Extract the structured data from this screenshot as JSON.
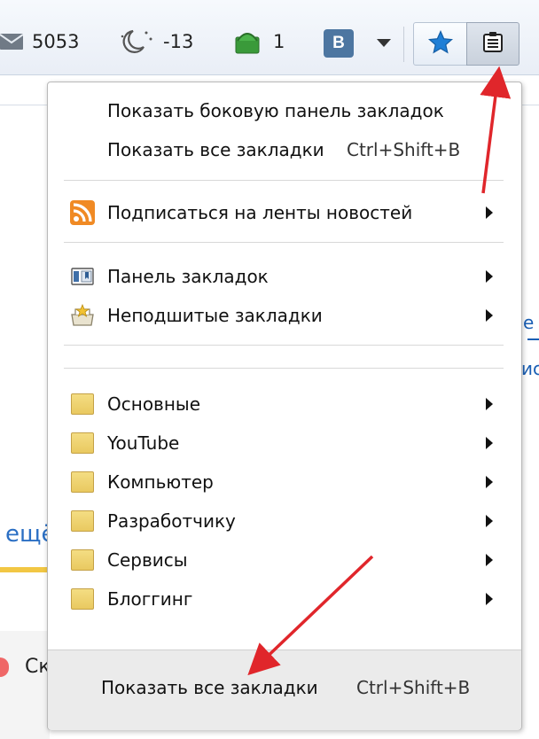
{
  "toolbar": {
    "mail_count": "5053",
    "weather_value": "-13",
    "green_count": "1",
    "vk_label": "В"
  },
  "background": {
    "left_text": "ещё",
    "left_snippet": "Ск",
    "right_text_1": "е",
    "right_text_2": "ис"
  },
  "menu": {
    "top_items": [
      {
        "label": "Показать боковую панель закладок"
      },
      {
        "label": "Показать все закладки",
        "shortcut": "Ctrl+Shift+B"
      }
    ],
    "feeds_item": {
      "label": "Подписаться на ленты новостей",
      "icon": "rss-icon"
    },
    "bar_items": [
      {
        "label": "Панель закладок",
        "icon": "bookmarks-toolbar-icon"
      },
      {
        "label": "Неподшитые закладки",
        "icon": "unsorted-bookmarks-icon"
      }
    ],
    "folders": [
      {
        "label": "Основные"
      },
      {
        "label": "YouTube"
      },
      {
        "label": "Компьютер"
      },
      {
        "label": "Разработчику"
      },
      {
        "label": "Сервисы"
      },
      {
        "label": "Блоггинг"
      }
    ],
    "footer": {
      "label": "Показать все закладки",
      "shortcut": "Ctrl+Shift+B"
    }
  },
  "colors": {
    "arrow_red": "#e0262b",
    "star_blue": "#1f7fd6",
    "vk_blue": "#4d76a1"
  }
}
